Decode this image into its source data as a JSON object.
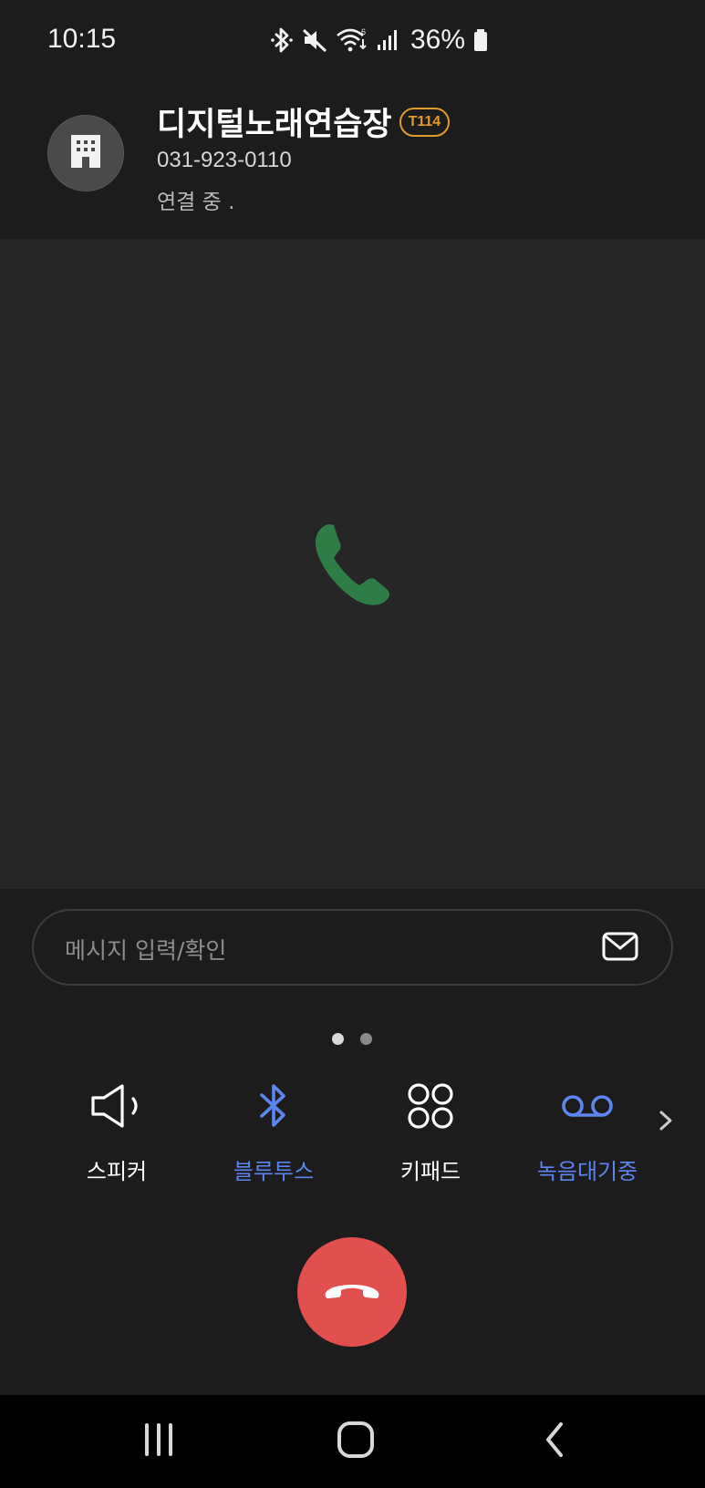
{
  "status_bar": {
    "time": "10:15",
    "battery": "36%",
    "icons": [
      "bluetooth-icon",
      "mute-icon",
      "wifi-icon",
      "signal-icon",
      "battery-icon"
    ]
  },
  "caller": {
    "name": "디지털노래연습장",
    "badge": "T114",
    "number": "031-923-0110",
    "status": "연결 중 .",
    "avatar_icon": "building-icon"
  },
  "message": {
    "placeholder": "메시지 입력/확인",
    "icon": "envelope-icon"
  },
  "pager": {
    "pages": 2,
    "active": 1
  },
  "actions": [
    {
      "label": "스피커",
      "icon": "speaker-icon",
      "color": "#ffffff"
    },
    {
      "label": "블루투스",
      "icon": "bluetooth-icon",
      "color": "#5b86f0"
    },
    {
      "label": "키패드",
      "icon": "keypad-icon",
      "color": "#ffffff"
    },
    {
      "label": "녹음대기중",
      "icon": "voicemail-icon",
      "color": "#5b86f0"
    }
  ],
  "colors": {
    "accent_blue": "#5b86f0",
    "end_call_red": "#e2504d",
    "call_green": "#2e7d46",
    "badge_orange": "#e39a2d"
  },
  "nav": [
    "recents-icon",
    "home-icon",
    "back-icon"
  ]
}
